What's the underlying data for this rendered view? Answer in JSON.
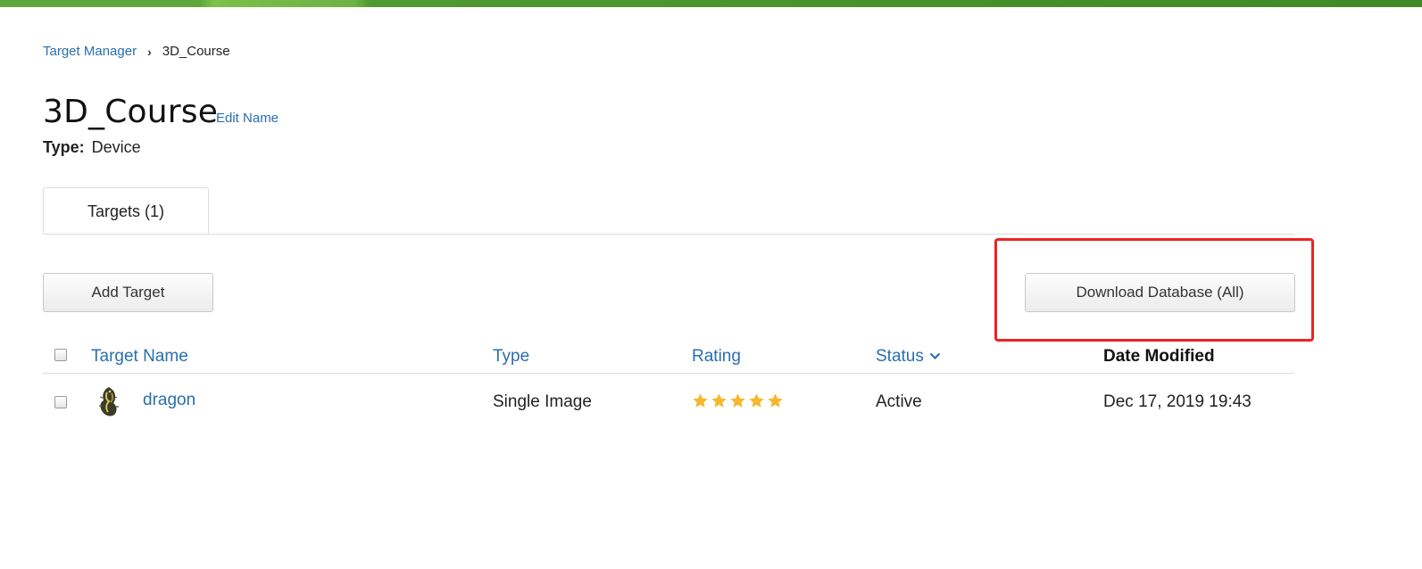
{
  "breadcrumb": {
    "root": "Target Manager",
    "separator": "›",
    "current": "3D_Course"
  },
  "header": {
    "title": "3D_Course",
    "edit_name": "Edit Name",
    "type_label": "Type:",
    "type_value": "Device"
  },
  "tabs": [
    {
      "label": "Targets (1)",
      "active": true
    }
  ],
  "toolbar": {
    "add_target": "Add Target",
    "download_database": "Download Database (All)"
  },
  "table": {
    "columns": [
      "Target Name",
      "Type",
      "Rating",
      "Status",
      "Date Modified"
    ],
    "sort_indicator": "chevron-down-icon",
    "rows": [
      {
        "name": "dragon",
        "thumbnail_icon": "dragon-thumbnail",
        "type": "Single Image",
        "rating": 5,
        "rating_max": 5,
        "status": "Active",
        "date_modified": "Dec 17, 2019 19:43"
      }
    ]
  },
  "colors": {
    "link": "#2a6eb0",
    "highlight": "#ee2222",
    "star": "#f5b82e",
    "top_bar": "#4f9a30"
  }
}
